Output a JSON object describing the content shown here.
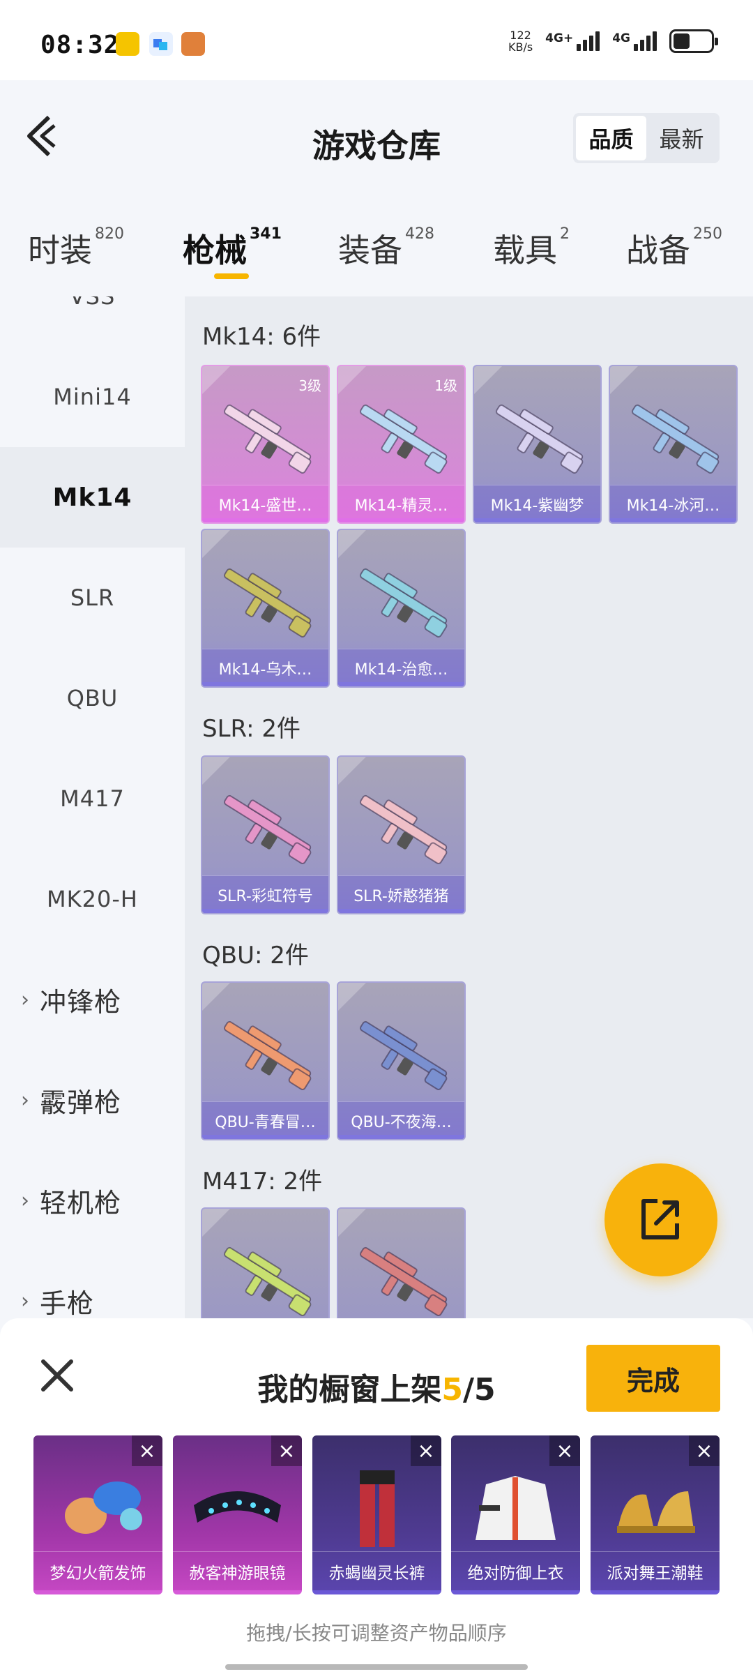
{
  "status": {
    "time": "08:32",
    "net_speed_value": "122",
    "net_speed_unit": "KB/s",
    "network1": "4G+",
    "network2": "4G",
    "battery_level": 0.45
  },
  "header": {
    "title": "游戏仓库",
    "sort_options": [
      "品质",
      "最新"
    ],
    "sort_selected": "品质"
  },
  "category_tabs": [
    {
      "label": "时装",
      "count": "820"
    },
    {
      "label": "枪械",
      "count": "341"
    },
    {
      "label": "装备",
      "count": "428"
    },
    {
      "label": "载具",
      "count": "2"
    },
    {
      "label": "战备",
      "count": "250"
    }
  ],
  "sidebar": {
    "cut_item": "VSS",
    "items": [
      "Mini14",
      "Mk14",
      "SLR",
      "QBU",
      "M417",
      "MK20-H"
    ],
    "active": "Mk14",
    "groups": [
      "冲锋枪",
      "霰弹枪",
      "轻机枪",
      "手枪"
    ]
  },
  "sections": [
    {
      "title": "Mk14: 6件",
      "items": [
        {
          "name": "Mk14-盛世…",
          "level": "3级",
          "quality": "pink",
          "color": "#f2d6e8"
        },
        {
          "name": "Mk14-精灵…",
          "level": "1级",
          "quality": "pink",
          "color": "#b9d9f2"
        },
        {
          "name": "Mk14-紫幽梦",
          "level": "",
          "quality": "purple",
          "color": "#d8d2f0"
        },
        {
          "name": "Mk14-冰河…",
          "level": "",
          "quality": "purple",
          "color": "#9fc4ea"
        },
        {
          "name": "Mk14-乌木…",
          "level": "",
          "quality": "purple",
          "color": "#c9c060"
        },
        {
          "name": "Mk14-治愈…",
          "level": "",
          "quality": "purple",
          "color": "#8fd0e0"
        }
      ]
    },
    {
      "title": "SLR: 2件",
      "items": [
        {
          "name": "SLR-彩虹符号",
          "level": "",
          "quality": "purple",
          "color": "#e596c8"
        },
        {
          "name": "SLR-娇憨猪猪",
          "level": "",
          "quality": "purple",
          "color": "#f0c0c8"
        }
      ]
    },
    {
      "title": "QBU: 2件",
      "items": [
        {
          "name": "QBU-青春冒…",
          "level": "",
          "quality": "purple",
          "color": "#ee9a70"
        },
        {
          "name": "QBU-不夜海…",
          "level": "",
          "quality": "purple",
          "color": "#7a90d0"
        }
      ]
    },
    {
      "title": "M417: 2件",
      "items": [
        {
          "name": "",
          "level": "",
          "quality": "purple",
          "color": "#c8e070"
        },
        {
          "name": "",
          "level": "",
          "quality": "purple",
          "color": "#d88080"
        }
      ]
    }
  ],
  "showcase": {
    "title_prefix": "我的橱窗上架",
    "current": "5",
    "total": "/5",
    "done_label": "完成",
    "hint": "拖拽/长按可调整资产物品顺序",
    "items": [
      {
        "name": "梦幻火箭发饰",
        "quality": "pink"
      },
      {
        "name": "赦客神游眼镜",
        "quality": "pink"
      },
      {
        "name": "赤蝎幽灵长裤",
        "quality": "purple"
      },
      {
        "name": "绝对防御上衣",
        "quality": "purple"
      },
      {
        "name": "派对舞王潮鞋",
        "quality": "purple"
      }
    ]
  },
  "colors": {
    "accent": "#f8b20c",
    "pink_quality": "#e07fe0",
    "purple_quality": "#8f89d6"
  }
}
